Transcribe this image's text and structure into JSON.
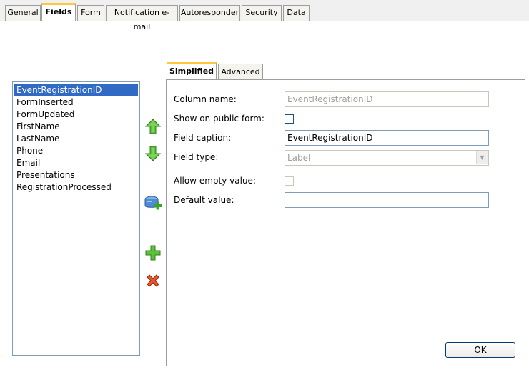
{
  "tabs": [
    {
      "label": "General"
    },
    {
      "label": "Fields"
    },
    {
      "label": "Form"
    },
    {
      "label": "Notification e-mail"
    },
    {
      "label": "Autoresponder"
    },
    {
      "label": "Security"
    },
    {
      "label": "Data"
    }
  ],
  "active_tab": "Fields",
  "field_list": {
    "items": [
      "EventRegistrationID",
      "FormInserted",
      "FormUpdated",
      "FirstName",
      "LastName",
      "Phone",
      "Email",
      "Presentations",
      "RegistrationProcessed"
    ],
    "selected": "EventRegistrationID"
  },
  "toolbar": {
    "move_up_icon": "green-up-arrow-icon",
    "move_down_icon": "green-down-arrow-icon",
    "new_from_db_icon": "database-add-icon",
    "add_icon": "green-plus-icon",
    "delete_icon": "red-x-icon"
  },
  "subtabs": [
    {
      "label": "Simplified"
    },
    {
      "label": "Advanced"
    }
  ],
  "active_subtab": "Simplified",
  "form": {
    "column_name_label": "Column name:",
    "column_name_value": "EventRegistrationID",
    "show_public_label": "Show on public form:",
    "show_public_checked": false,
    "caption_label": "Field caption:",
    "caption_value": "EventRegistrationID",
    "type_label": "Field type:",
    "type_value": "Label",
    "allow_empty_label": "Allow empty value:",
    "allow_empty_checked": false,
    "default_label": "Default value:",
    "default_value": ""
  },
  "ok_label": "OK",
  "colors": {
    "selection": "#316ac5",
    "active_tab_accent": "#ffc83c",
    "border": "#9d9da1"
  }
}
